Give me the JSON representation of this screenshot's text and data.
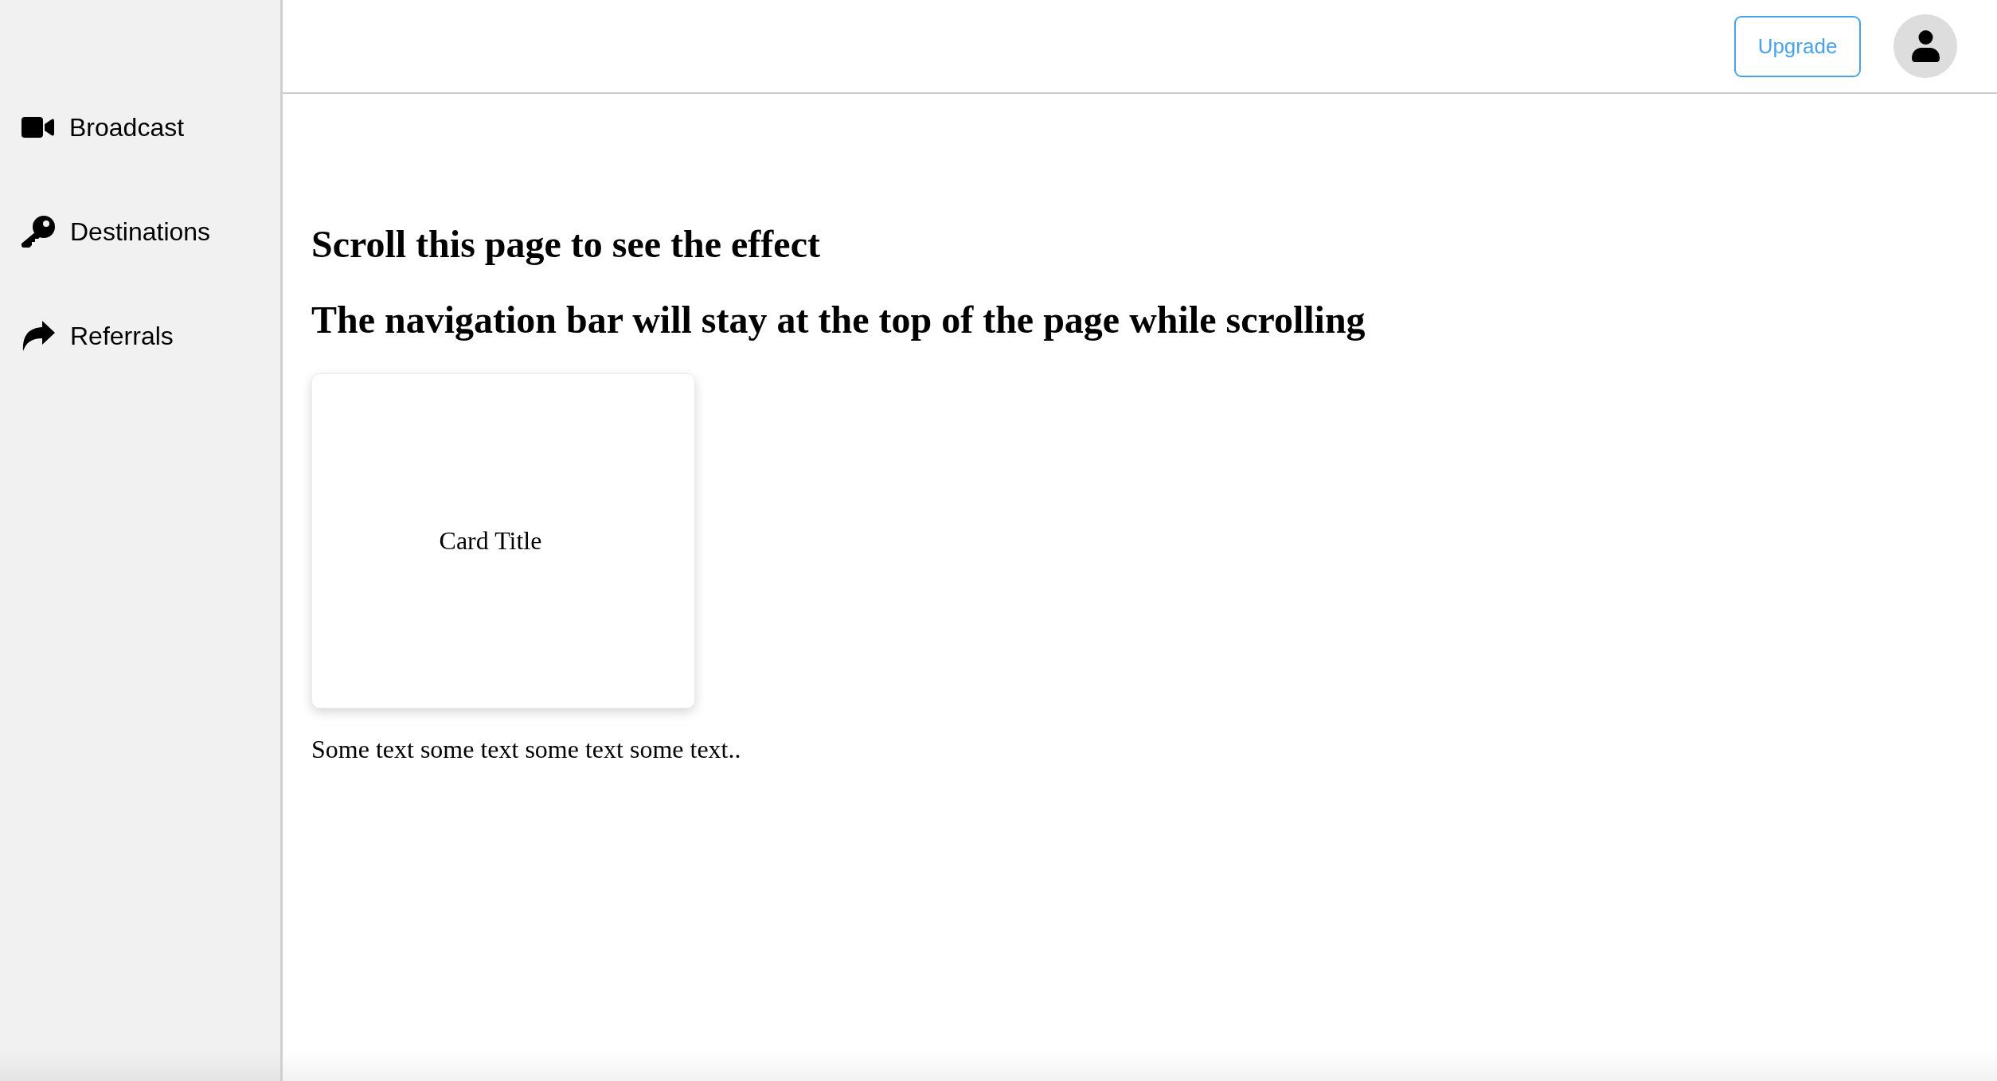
{
  "sidebar": {
    "items": [
      {
        "label": "Broadcast",
        "kind": "video"
      },
      {
        "label": "Destinations",
        "kind": "key"
      },
      {
        "label": "Referrals",
        "kind": "share"
      }
    ]
  },
  "top_bar": {
    "upgrade_button": "Upgrade"
  },
  "main": {
    "headings": [
      "Scroll this page to see the effect",
      "The navigation bar will stay at the top of the page while scrolling"
    ],
    "card": {
      "title": "Card Title"
    },
    "paragraph": "Some text some text some text some text.."
  }
}
